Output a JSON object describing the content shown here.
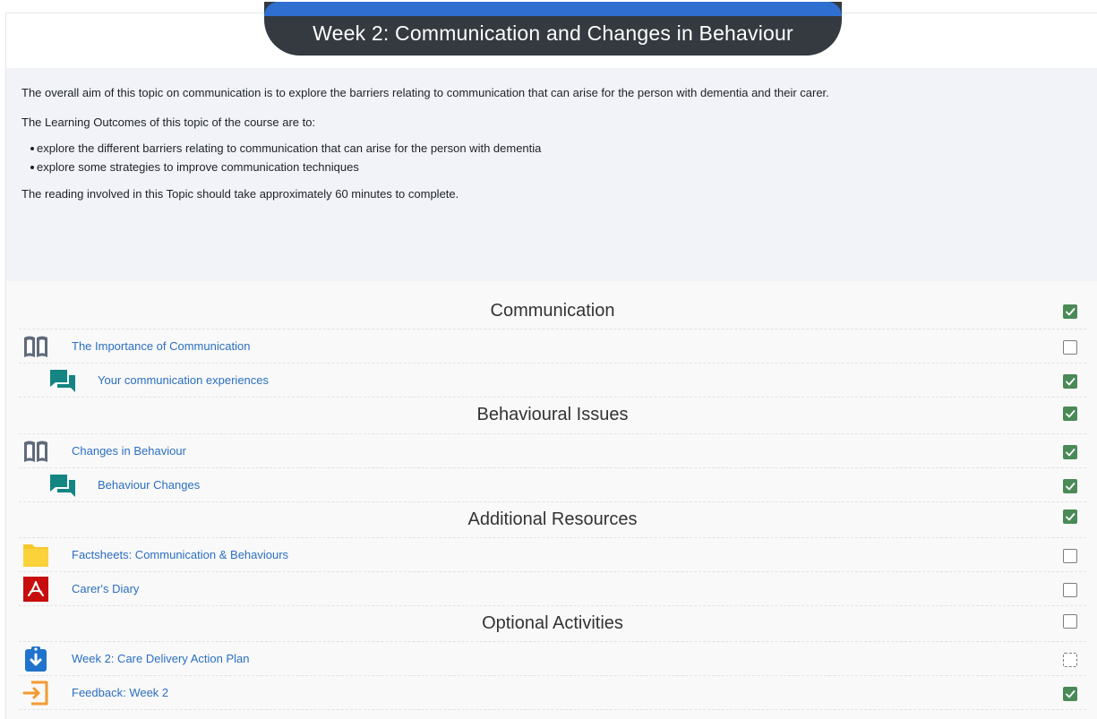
{
  "week": {
    "title": "Week 2: Communication and Changes in Behaviour"
  },
  "summary": {
    "intro": "The overall aim of this topic on communication is to explore the barriers relating to communication that can arise for the person with dementia and their carer.",
    "outcomes_heading": "The Learning Outcomes of this topic of the course are to:",
    "outcomes": [
      "explore the different barriers relating to communication that can arise for the person with dementia",
      "explore some strategies to improve communication techniques"
    ],
    "reading_time": "The reading involved in this Topic should take approximately 60 minutes to complete."
  },
  "sections": [
    {
      "title": "Communication",
      "completion": "complete",
      "items": [
        {
          "label": "The Importance of Communication",
          "icon": "book-icon",
          "completion": "incomplete",
          "indent": 0
        },
        {
          "label": "Your communication experiences",
          "icon": "forum-icon",
          "completion": "complete",
          "indent": 1
        }
      ]
    },
    {
      "title": "Behavioural Issues",
      "completion": "complete",
      "items": [
        {
          "label": "Changes in Behaviour",
          "icon": "book-icon",
          "completion": "complete",
          "indent": 0
        },
        {
          "label": "Behaviour Changes",
          "icon": "forum-icon",
          "completion": "complete",
          "indent": 1
        }
      ]
    },
    {
      "title": "Additional Resources",
      "completion": "complete",
      "items": [
        {
          "label": "Factsheets: Communication & Behaviours",
          "icon": "folder-icon",
          "completion": "incomplete",
          "indent": 0
        },
        {
          "label": "Carer's Diary",
          "icon": "pdf-icon",
          "completion": "incomplete",
          "indent": 0
        }
      ]
    },
    {
      "title": "Optional Activities",
      "completion": "incomplete",
      "items": [
        {
          "label": "Week 2: Care Delivery Action Plan",
          "icon": "assignment-icon",
          "completion": "auto-incomplete",
          "indent": 0
        },
        {
          "label": "Feedback: Week 2",
          "icon": "feedback-icon",
          "completion": "complete",
          "indent": 0
        }
      ]
    }
  ],
  "colors": {
    "link": "#2a6fc1",
    "check_complete": "#4a8a57",
    "title_bar": "#343a40",
    "title_accent": "#2f6fcf"
  }
}
